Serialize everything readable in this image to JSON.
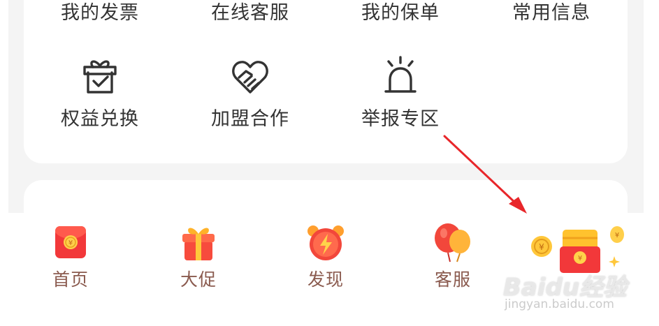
{
  "services": {
    "row1": [
      {
        "label": "我的发票"
      },
      {
        "label": "在线客服"
      },
      {
        "label": "我的保单"
      },
      {
        "label": "常用信息"
      }
    ],
    "row2": [
      {
        "label": "权益兑换",
        "icon": "gift-box-check-icon"
      },
      {
        "label": "加盟合作",
        "icon": "handshake-heart-icon"
      },
      {
        "label": "举报专区",
        "icon": "alarm-light-icon"
      }
    ]
  },
  "tabbar": {
    "tabs": [
      {
        "label": "首页",
        "icon": "red-envelope-icon"
      },
      {
        "label": "大促",
        "icon": "gift-icon"
      },
      {
        "label": "发现",
        "icon": "alarm-clock-lightning-icon"
      },
      {
        "label": "客服",
        "icon": "balloons-icon"
      },
      {
        "label": "",
        "icon": "red-packet-coins-icon"
      }
    ]
  },
  "watermark": {
    "main": "Baidu经验",
    "sub": "jingyan.baidu.com"
  },
  "colors": {
    "page_bg": "#f4f4f4",
    "card_bg": "#ffffff",
    "text_dark": "#333333",
    "tab_text": "#8a5a4e",
    "arrow": "#e8262a"
  }
}
